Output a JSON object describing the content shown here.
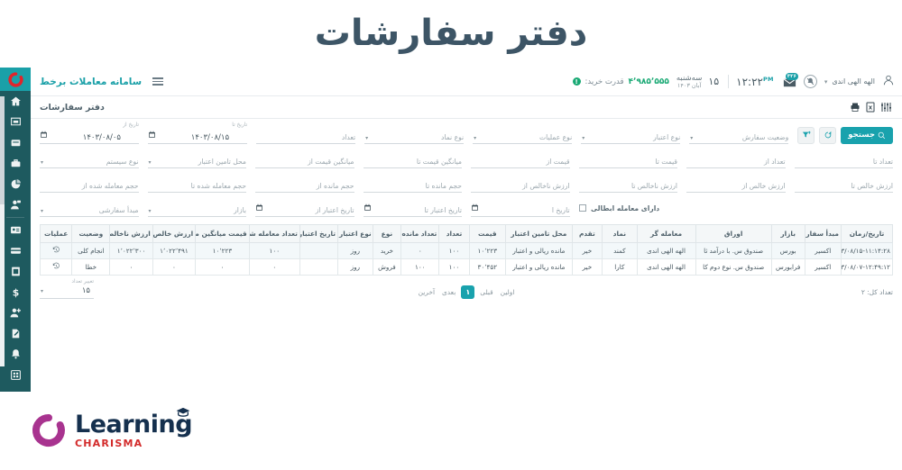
{
  "hero": {
    "title": "دفتر سفارشات"
  },
  "topbar": {
    "brand": "سامانه معاملات برخط",
    "menu_icon": "hamburger-icon",
    "logo_icon": "charisma-c-logo",
    "buying_power_label": "قدرت خرید:",
    "buying_power_value": "۴٬۹۸۵٬۵۵۵",
    "buying_power_badge": "!",
    "date_weekday": "سه‌شنبه",
    "date_number": "۱۵",
    "date_month_year": "آبان ۱۴۰۳",
    "time": "۱۲:۲۲",
    "time_meridiem": "PM",
    "mail_badge": "۳۲۶",
    "user_name": "الهه الهی اندی",
    "user_caret": "▾"
  },
  "toolbar": {
    "page_title": "دفتر سفارشات",
    "icons": [
      "settings-sliders-icon",
      "excel-export-icon",
      "print-icon"
    ]
  },
  "filters": {
    "date_from": {
      "float": "تاریخ از",
      "value": "۱۴۰۳/۰۸/۰۵"
    },
    "date_to": {
      "float": "تاریخ تا",
      "value": "۱۴۰۳/۰۸/۱۵"
    },
    "count": {
      "label": "تعداد"
    },
    "symbol_type": {
      "label": "نوع نماد"
    },
    "operation_type": {
      "label": "نوع عملیات"
    },
    "credit_type": {
      "label": "نوع اعتبار"
    },
    "order_status": {
      "label": "وضعیت سفارش"
    },
    "system_type": {
      "label": "نوع سیستم"
    },
    "credit_source": {
      "label": "محل تامین اعتبار"
    },
    "avg_price_from": {
      "label": "میانگین قیمت از"
    },
    "avg_price_to": {
      "label": "میانگین قیمت تا"
    },
    "price_from": {
      "label": "قیمت از"
    },
    "price_to": {
      "label": "قیمت تا"
    },
    "count_from": {
      "label": "تعداد از"
    },
    "count_to": {
      "label": "تعداد تا"
    },
    "traded_volume_from": {
      "label": "حجم معامله شده از"
    },
    "traded_volume_to": {
      "label": "حجم معامله شده تا"
    },
    "remaining_volume_from": {
      "label": "حجم مانده از"
    },
    "remaining_volume_to": {
      "label": "حجم مانده تا"
    },
    "gross_value_from": {
      "label": "ارزش ناخالص از"
    },
    "gross_value_to": {
      "label": "ارزش ناخالص تا"
    },
    "net_value_from": {
      "label": "ارزش خالص از"
    },
    "net_value_to": {
      "label": "ارزش خالص تا"
    },
    "order_origin": {
      "label": "مبدأ سفارشی"
    },
    "market": {
      "label": "بازار"
    },
    "validity_from": {
      "label": "تاریخ اعتبار از"
    },
    "validity_to": {
      "label": "تاریخ اعتبار تا"
    },
    "validity_to2": {
      "label": "تاریخ ا"
    },
    "cancelled_trade": {
      "label": "دارای معامله ابطالی"
    },
    "search_button": "جستجو",
    "refresh_icon": "refresh-icon",
    "filter_icon": "filter-collapse-icon"
  },
  "table": {
    "columns": [
      "تاریخ/زمان",
      "مبدأ سفارش",
      "بازار",
      "اوراق",
      "معامله گر",
      "نماد",
      "تقدم",
      "محل تامین اعتبار",
      "قیمت",
      "تعداد",
      "تعداد مانده",
      "نوع",
      "نوع اعتبار",
      "تاریخ اعتبار",
      "تعداد معامله شده",
      "قیمت میانگین معامله",
      "ارزش خالص",
      "ارزش ناخالص",
      "وضعیت",
      "عملیات"
    ],
    "rows": [
      {
        "datetime": "۱۴۰۳/۰۸/۱۵-۱۱:۱۴:۲۸",
        "origin": "اکسیر",
        "market": "بورس",
        "security": "صندوق س. با درآمد ثا",
        "trader": "الهه الهی اندی",
        "symbol": "کمند",
        "priority": "خیر",
        "credit_source": "مانده ریالی و اعتبار",
        "price": "۱۰٬۲۲۳",
        "count": "۱۰۰",
        "remaining": "۰",
        "type": "خرید",
        "credit_type": "روز",
        "validity_date": "",
        "traded_count": "۱۰۰",
        "avg_price": "۱۰٬۲۲۳",
        "net_value": "۱٬۰۲۲٬۴۹۱",
        "gross_value": "۱٬۰۲۲٬۳۰۰",
        "status": "انجام کلی",
        "action_icon": "history-revert-icon"
      },
      {
        "datetime": "۱۴۰۳/۰۸/۰۷-۱۲:۴۹:۱۲",
        "origin": "اکسیر",
        "market": "فرابورس",
        "security": "صندوق س. نوع دوم کا",
        "trader": "الهه الهی اندی",
        "symbol": "کارا",
        "priority": "خیر",
        "credit_source": "مانده ریالی و اعتبار",
        "price": "۳۰٬۴۵۲",
        "count": "۱۰۰",
        "remaining": "۱۰۰",
        "type": "فروش",
        "credit_type": "روز",
        "validity_date": "",
        "traded_count": "۰",
        "avg_price": "۰",
        "net_value": "۰",
        "gross_value": "۰",
        "status": "خطا",
        "action_icon": "history-revert-icon"
      }
    ]
  },
  "footer": {
    "total_label": "تعداد کل: ۲",
    "pager": {
      "first": "اولین",
      "prev": "قبلی",
      "current": "۱",
      "next": "بعدی",
      "last": "آخرین"
    },
    "rows_per_page_label": "تغییر تعداد",
    "rows_per_page_value": "۱۵",
    "rows_caret": "▾"
  },
  "brand_footer": {
    "word_main": "Learning",
    "word_sub": "CHARISMA"
  },
  "sidebar": {
    "items": [
      "home-icon",
      "monitor-icon",
      "briefcase-icon",
      "bag-icon",
      "pie-chart-icon",
      "person-money-icon",
      "id-card-icon",
      "credit-card-icon",
      "document-icon",
      "dollar-icon",
      "add-user-icon",
      "edit-document-icon",
      "bell-icon",
      "grid-icon"
    ]
  },
  "colors": {
    "accent": "#19a2ad",
    "sidebar": "#1e5a5f",
    "title": "#3d5566",
    "positive": "#19a974",
    "brand_red": "#d32b2b",
    "brand_navy": "#15304e",
    "brand_purple": "#a8338f"
  }
}
